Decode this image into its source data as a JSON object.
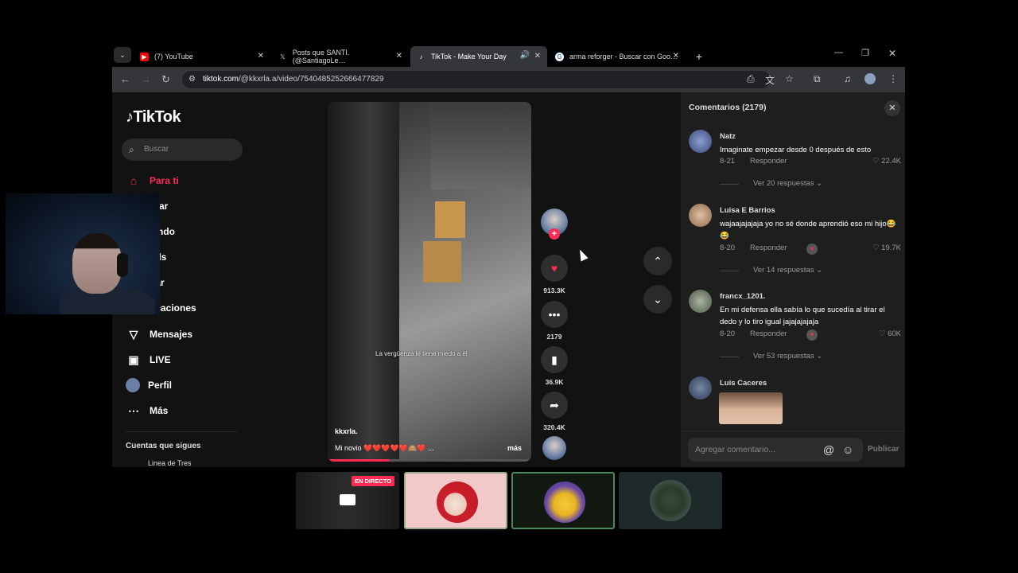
{
  "browser": {
    "tabs": [
      {
        "title": "(7) YouTube",
        "icon": "youtube-icon",
        "favicon_color": "#ff0000"
      },
      {
        "title": "Posts que SANTI. (@SantiagoLe…",
        "icon": "x-icon",
        "favicon_color": "#ffffff"
      },
      {
        "title": "TikTok - Make Your Day",
        "icon": "tiktok-icon",
        "favicon_color": "#ffffff"
      },
      {
        "title": "arma reforger - Buscar con Goo…",
        "icon": "google-icon",
        "favicon_color": "#4285f4"
      }
    ],
    "new_tab_symbol": "+",
    "url_domain": "tiktok.com",
    "url_path": "/@kkxrla.a/video/7540485252666477829"
  },
  "sidebar": {
    "logo": "TikTok",
    "search_placeholder": "Buscar",
    "items": [
      {
        "label": "Para ti",
        "icon": "home-icon"
      },
      {
        "label": "orar",
        "icon": "explore-icon"
      },
      {
        "label": "iendo",
        "icon": "following-icon"
      },
      {
        "label": "nds",
        "icon": "friends-icon"
      },
      {
        "label": "gar",
        "icon": "upload-icon"
      },
      {
        "label": "ficaciones",
        "icon": "notifications-icon"
      },
      {
        "label": "Mensajes",
        "icon": "messages-icon"
      },
      {
        "label": "LIVE",
        "icon": "live-icon"
      },
      {
        "label": "Perfil",
        "icon": "profile-icon"
      },
      {
        "label": "Más",
        "icon": "more-icon"
      }
    ],
    "following_heading": "Cuentas que sigues",
    "following_first": "Linea de Tres"
  },
  "video": {
    "overlay_caption": "La vergüenza le tiene miedo a él",
    "author": "kkxrla.",
    "description": "Mi novio ❤️❤️❤️❤️❤️🙈❤️ ...",
    "more_label": "más",
    "progress": 0.3
  },
  "actions": {
    "likes": "913.3K",
    "comments": "2179",
    "saves": "36.9K",
    "shares": "320.4K"
  },
  "comments": {
    "title": "Comentarios (2179)",
    "reply_label": "Responder",
    "items": [
      {
        "name": "Natz",
        "text": "Imaginate empezar desde 0 después de esto",
        "date": "8-21",
        "likes": "22.4K",
        "replies": "Ver 20 respuestas"
      },
      {
        "name": "Luisa E Barrios",
        "text": "wajaajajajaja yo no sé donde aprendió eso mi hijo😂😂",
        "date": "8-20",
        "likes": "19.7K",
        "replies": "Ver 14 respuestas"
      },
      {
        "name": "francx_1201.",
        "text": "En mi defensa ella sabía lo que sucedía al tirar el dedo y lo tiro igual jajajajajaja",
        "date": "8-20",
        "likes": "60K",
        "replies": "Ver 53 respuestas"
      },
      {
        "name": "Luis Caceres"
      }
    ],
    "input_placeholder": "Agregar comentario...",
    "post_label": "Publicar"
  },
  "thumbnails": {
    "live_badge": "EN DIRECTO"
  },
  "colors": {
    "accent": "#fe2c55",
    "panel": "#1e1e1e",
    "background": "#121212"
  }
}
